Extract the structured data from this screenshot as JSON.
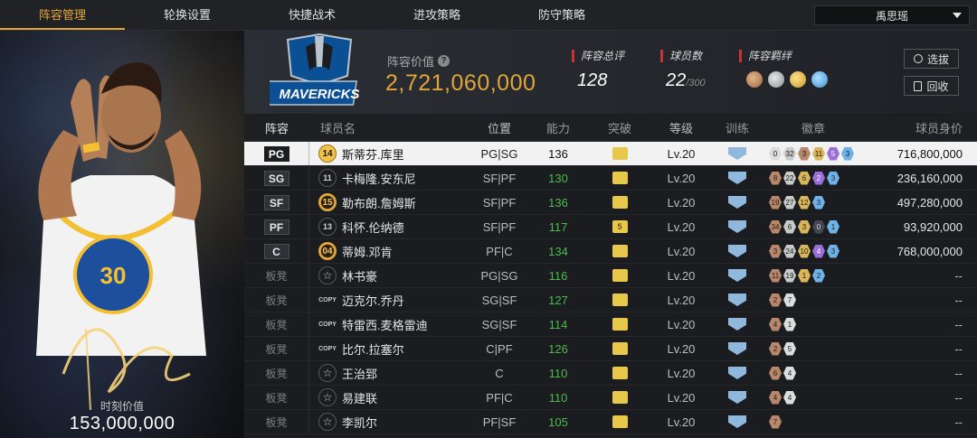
{
  "nav": {
    "tabs": [
      "阵容管理",
      "轮换设置",
      "快捷战术",
      "进攻策略",
      "防守策略"
    ],
    "active_tab": 0,
    "user": "禹思瑶"
  },
  "portrait": {
    "value_label": "时刻价值",
    "value": "153,000,000"
  },
  "team": {
    "logo_text": "MAVERICKS",
    "lineup_label": "阵容价值",
    "lineup_value": "2,721,060,000",
    "overall_label": "阵容总评",
    "overall_value": "128",
    "count_label": "球员数",
    "count_value": "22",
    "count_max": "/300",
    "bonds_label": "阵容羁绊",
    "bond_icons": [
      "bond-icon-1",
      "bond-icon-2",
      "bond-icon-3",
      "bond-icon-4"
    ],
    "btn_pull": "选拔",
    "btn_back": "回收"
  },
  "table": {
    "headers": {
      "role": "阵容",
      "name": "球员名",
      "pos": "位置",
      "ability": "能力",
      "breakthrough": "突破",
      "level": "等级",
      "training": "训练",
      "badges": "徽章",
      "salary": "球员身价"
    },
    "rows": [
      {
        "role": "PG",
        "bench": false,
        "jersey": "14",
        "jtype": "gold",
        "name": "斯蒂芬.库里",
        "pos": "PG|SG",
        "ability": "136",
        "brk": "",
        "level": "Lv.20",
        "badges": [
          [
            "0",
            "light"
          ],
          [
            "32",
            "silver"
          ],
          [
            "3",
            "bronze"
          ],
          [
            "11",
            "gold"
          ],
          [
            "5",
            "purple"
          ],
          [
            "3",
            "blue"
          ]
        ],
        "salary": "716,800,000"
      },
      {
        "role": "SG",
        "bench": false,
        "jersey": "11",
        "jtype": "plain",
        "name": "卡梅隆.安东尼",
        "pos": "SF|PF",
        "ability": "130",
        "brk": "",
        "level": "Lv.20",
        "badges": [
          [
            "8",
            "bronze"
          ],
          [
            "22",
            "silver"
          ],
          [
            "6",
            "gold"
          ],
          [
            "2",
            "purple"
          ],
          [
            "3",
            "blue"
          ]
        ],
        "salary": "236,160,000"
      },
      {
        "role": "SF",
        "bench": false,
        "jersey": "15",
        "jtype": "gold",
        "name": "勒布朗.詹姆斯",
        "pos": "SF|PF",
        "ability": "136",
        "brk": "",
        "level": "Lv.20",
        "badges": [
          [
            "19",
            "bronze"
          ],
          [
            "27",
            "silver"
          ],
          [
            "12",
            "gold"
          ],
          [
            "3",
            "blue"
          ]
        ],
        "salary": "497,280,000"
      },
      {
        "role": "PF",
        "bench": false,
        "jersey": "13",
        "jtype": "plain",
        "name": "科怀.伦纳德",
        "pos": "SF|PF",
        "ability": "117",
        "brk": "5",
        "level": "Lv.20",
        "badges": [
          [
            "34",
            "bronze"
          ],
          [
            "6",
            "silver"
          ],
          [
            "3",
            "gold"
          ],
          [
            "0",
            "dark"
          ],
          [
            "1",
            "blue"
          ]
        ],
        "salary": "93,920,000"
      },
      {
        "role": "C",
        "bench": false,
        "jersey": "04",
        "jtype": "gold",
        "name": "蒂姆.邓肯",
        "pos": "PF|C",
        "ability": "134",
        "brk": "",
        "level": "Lv.20",
        "badges": [
          [
            "3",
            "bronze"
          ],
          [
            "24",
            "silver"
          ],
          [
            "10",
            "gold"
          ],
          [
            "4",
            "purple"
          ],
          [
            "3",
            "blue"
          ]
        ],
        "salary": "768,000,000"
      },
      {
        "role": "板凳",
        "bench": true,
        "jersey": "☆",
        "jtype": "star",
        "name": "林书豪",
        "pos": "PG|SG",
        "ability": "116",
        "brk": "",
        "level": "Lv.20",
        "badges": [
          [
            "11",
            "bronze"
          ],
          [
            "19",
            "silver"
          ],
          [
            "1",
            "gold"
          ],
          [
            "2",
            "blue"
          ]
        ],
        "salary": "--"
      },
      {
        "role": "板凳",
        "bench": true,
        "jersey": "COPY",
        "jtype": "copy",
        "name": "迈克尔.乔丹",
        "pos": "SG|SF",
        "ability": "127",
        "brk": "",
        "level": "Lv.20",
        "badges": [
          [
            "2",
            "bronze"
          ],
          [
            "7",
            "light"
          ]
        ],
        "salary": "--"
      },
      {
        "role": "板凳",
        "bench": true,
        "jersey": "COPY",
        "jtype": "copy",
        "name": "特雷西.麦格雷迪",
        "pos": "SG|SF",
        "ability": "114",
        "brk": "",
        "level": "Lv.20",
        "badges": [
          [
            "4",
            "bronze"
          ],
          [
            "1",
            "light"
          ]
        ],
        "salary": "--"
      },
      {
        "role": "板凳",
        "bench": true,
        "jersey": "COPY",
        "jtype": "copy",
        "name": "比尔.拉塞尔",
        "pos": "C|PF",
        "ability": "126",
        "brk": "",
        "level": "Lv.20",
        "badges": [
          [
            "2",
            "bronze"
          ],
          [
            "5",
            "light"
          ]
        ],
        "salary": "--"
      },
      {
        "role": "板凳",
        "bench": true,
        "jersey": "☆",
        "jtype": "star",
        "name": "王治郅",
        "pos": "C",
        "ability": "110",
        "brk": "",
        "level": "Lv.20",
        "badges": [
          [
            "6",
            "bronze"
          ],
          [
            "4",
            "light"
          ]
        ],
        "salary": "--"
      },
      {
        "role": "板凳",
        "bench": true,
        "jersey": "☆",
        "jtype": "star",
        "name": "易建联",
        "pos": "PF|C",
        "ability": "110",
        "brk": "",
        "level": "Lv.20",
        "badges": [
          [
            "4",
            "bronze"
          ],
          [
            "4",
            "light"
          ]
        ],
        "salary": "--"
      },
      {
        "role": "板凳",
        "bench": true,
        "jersey": "☆",
        "jtype": "star",
        "name": "李凯尔",
        "pos": "PF|SF",
        "ability": "105",
        "brk": "",
        "level": "Lv.20",
        "badges": [
          [
            "7",
            "bronze"
          ]
        ],
        "salary": "--"
      }
    ]
  },
  "colors": {
    "accent": "#e2a53c",
    "ability_green": "#4dbb4a",
    "stat_marker": "#c8323a"
  }
}
